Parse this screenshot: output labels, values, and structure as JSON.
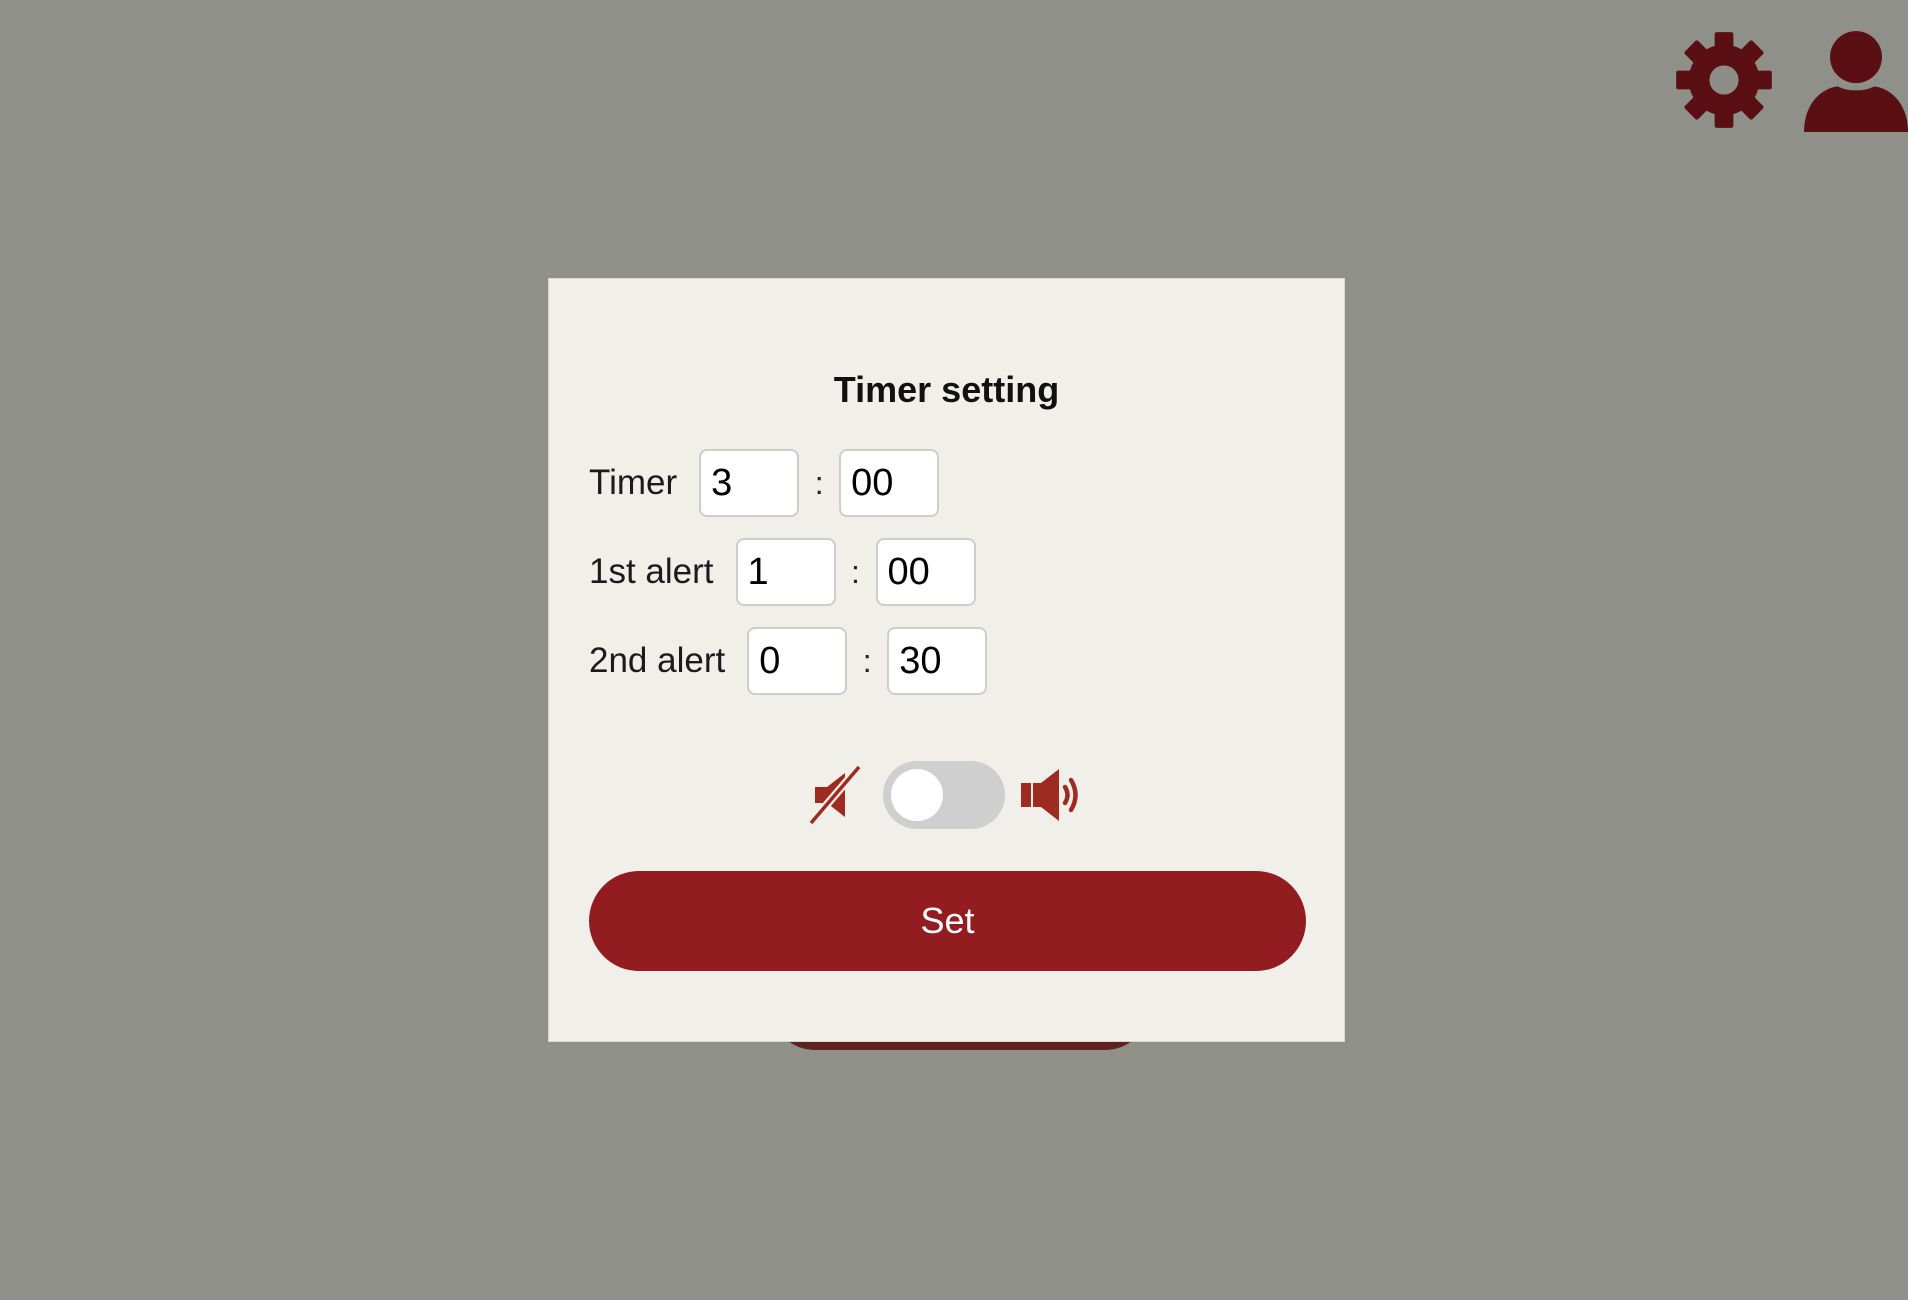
{
  "header": {
    "settings_icon": "gear-icon",
    "account_icon": "user-icon",
    "icon_color": "#5a1012"
  },
  "modal": {
    "title": "Timer setting",
    "rows": [
      {
        "label": "Timer",
        "minutes": "3",
        "seconds": "00"
      },
      {
        "label": "1st alert",
        "minutes": "1",
        "seconds": "00"
      },
      {
        "label": "2nd alert",
        "minutes": "0",
        "seconds": "30"
      }
    ],
    "separator": ":",
    "sound": {
      "mute_icon": "speaker-mute-icon",
      "on_icon": "speaker-volume-icon",
      "enabled": false
    },
    "set_button_label": "Set",
    "accent_color": "#921c1f"
  }
}
